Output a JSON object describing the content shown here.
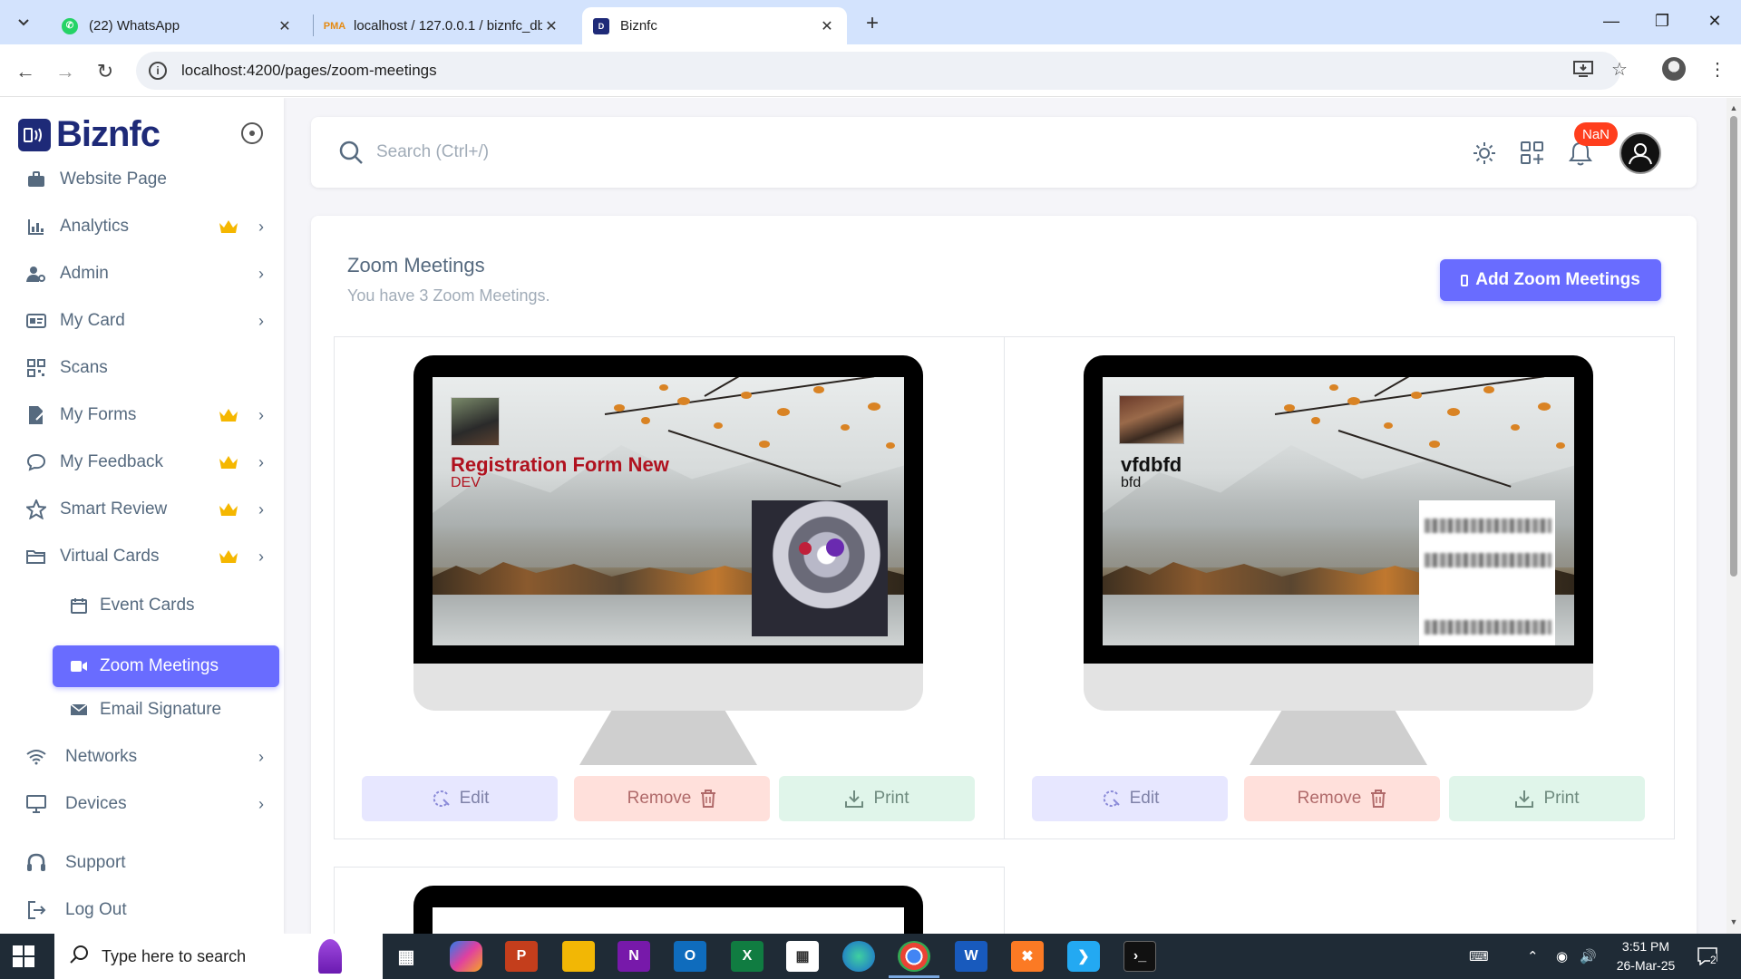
{
  "browser": {
    "tabs": [
      {
        "title": "(22) WhatsApp",
        "favicon": "whatsapp-icon",
        "active": false
      },
      {
        "title": "localhost / 127.0.0.1 / biznfc_db",
        "favicon": "phpmyadmin-icon",
        "active": false
      },
      {
        "title": "Biznfc",
        "favicon": "biznfc-icon",
        "active": true
      }
    ],
    "url": "localhost:4200/pages/zoom-meetings"
  },
  "sidebar": {
    "brand": "Biznfc",
    "items": [
      {
        "label": "Website Page",
        "icon": "briefcase-icon",
        "premium": false,
        "has_children": false
      },
      {
        "label": "Analytics",
        "icon": "analytics-icon",
        "premium": true,
        "has_children": true
      },
      {
        "label": "Admin",
        "icon": "admin-icon",
        "premium": false,
        "has_children": true
      },
      {
        "label": "My Card",
        "icon": "card-icon",
        "premium": false,
        "has_children": true
      },
      {
        "label": "Scans",
        "icon": "qr-scan-icon",
        "premium": false,
        "has_children": false
      },
      {
        "label": "My Forms",
        "icon": "form-icon",
        "premium": true,
        "has_children": true
      },
      {
        "label": "My Feedback",
        "icon": "chat-icon",
        "premium": true,
        "has_children": true
      },
      {
        "label": "Smart Review",
        "icon": "star-icon",
        "premium": true,
        "has_children": true
      },
      {
        "label": "Virtual Cards",
        "icon": "folder-icon",
        "premium": true,
        "has_children": true
      }
    ],
    "sub_items": [
      {
        "label": "Event Cards",
        "icon": "calendar-icon",
        "active": false
      },
      {
        "label": "Zoom Meetings",
        "icon": "video-icon",
        "active": true
      },
      {
        "label": "Email Signature",
        "icon": "envelope-icon",
        "active": false
      }
    ],
    "items_bottom": [
      {
        "label": "Networks",
        "icon": "wifi-icon",
        "has_children": true
      },
      {
        "label": "Devices",
        "icon": "monitor-icon",
        "has_children": true
      }
    ],
    "footer": [
      {
        "label": "Support",
        "icon": "headset-icon"
      },
      {
        "label": "Log Out",
        "icon": "logout-icon"
      }
    ]
  },
  "topnav": {
    "search_placeholder": "Search (Ctrl+/)",
    "notification_badge": "NaN"
  },
  "page": {
    "title": "Zoom Meetings",
    "subtitle": "You have 3 Zoom Meetings.",
    "add_button": "Add Zoom Meetings"
  },
  "cards": [
    {
      "name": "Registration Form New",
      "role": "DEV",
      "edit": "Edit",
      "remove": "Remove",
      "print": "Print"
    },
    {
      "name": "vfdbfd",
      "role": "bfd",
      "edit": "Edit",
      "remove": "Remove",
      "print": "Print"
    }
  ],
  "taskbar": {
    "search_placeholder": "Type here to search",
    "time": "3:51 PM",
    "date": "26-Mar-25",
    "notification_count": "2"
  },
  "colors": {
    "primary": "#696cff",
    "brand": "#1e2a78",
    "crown": "#f5b700",
    "danger": "#ff3e1d"
  }
}
